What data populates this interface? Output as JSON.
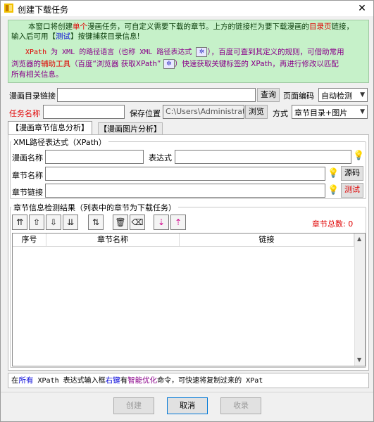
{
  "window": {
    "title": "创建下载任务",
    "close_glyph": "✕"
  },
  "info": {
    "l1a": "本窗口将创建",
    "l1b": "单个",
    "l1c": "漫画任务，可自定义需要下载的章节。上方的链接栏为要下载漫画的",
    "l1d": "目录页",
    "l1e": "链接，",
    "l2a": "输入后可用【",
    "l2b": "测试",
    "l2c": "】按键捕获目录信息!",
    "l3a": "XPath",
    "l3b": " 为 XML 的路径语言（也称 XML 路径表达式 ",
    "l3c": "），百度可查到其定义的规则，可借助常用",
    "l4a": "浏览器的",
    "l4b": "辅助工具",
    "l4c": "（百度“浏览器 获取XPath” ",
    "l4d": "）快速获取关键标签的 XPath，再进行修改以匹配",
    "l5": "所有相关信息。"
  },
  "form": {
    "url_label": "漫画目录链接",
    "url_value": "",
    "query_btn": "查询",
    "encoding_label": "页面编码",
    "encoding_value": "自动检测",
    "task_label": "任务名称",
    "task_value": "",
    "save_label": "保存位置",
    "save_path": "C:\\Users\\Administrato",
    "browse_btn": "浏览",
    "mode_label": "方式",
    "mode_value": "章节目录+图片"
  },
  "tabs": [
    {
      "label": "【漫画章节信息分析】"
    },
    {
      "label": "【漫画图片分析】"
    }
  ],
  "xpath_group": {
    "title": "XML路径表达式（XPath）",
    "comic_name_label": "漫画名称",
    "expr_label": "表达式",
    "chapter_name_label": "章节名称",
    "chapter_link_label": "章节链接",
    "source_btn": "源码",
    "test_btn": "测试"
  },
  "results_group": {
    "title": "章节信息检测结果（列表中的章节为下载任务）",
    "total_label": "章节总数: 0",
    "columns": [
      "序号",
      "章节名称",
      "链接"
    ]
  },
  "toolbar_icons": [
    "move-top",
    "move-up",
    "move-down",
    "move-bottom",
    "reverse",
    "delete",
    "clear",
    "sort-desc",
    "sort-asc"
  ],
  "status_bar": {
    "a": "在",
    "b": "所有",
    "c": " XPath 表达式输入框",
    "d": "右键",
    "e": "有",
    "f": "智能优化",
    "g": "命令，可快速将复制过来的 XPat"
  },
  "bottom_buttons": {
    "create": "创建",
    "cancel": "取消",
    "collect": "收录"
  }
}
